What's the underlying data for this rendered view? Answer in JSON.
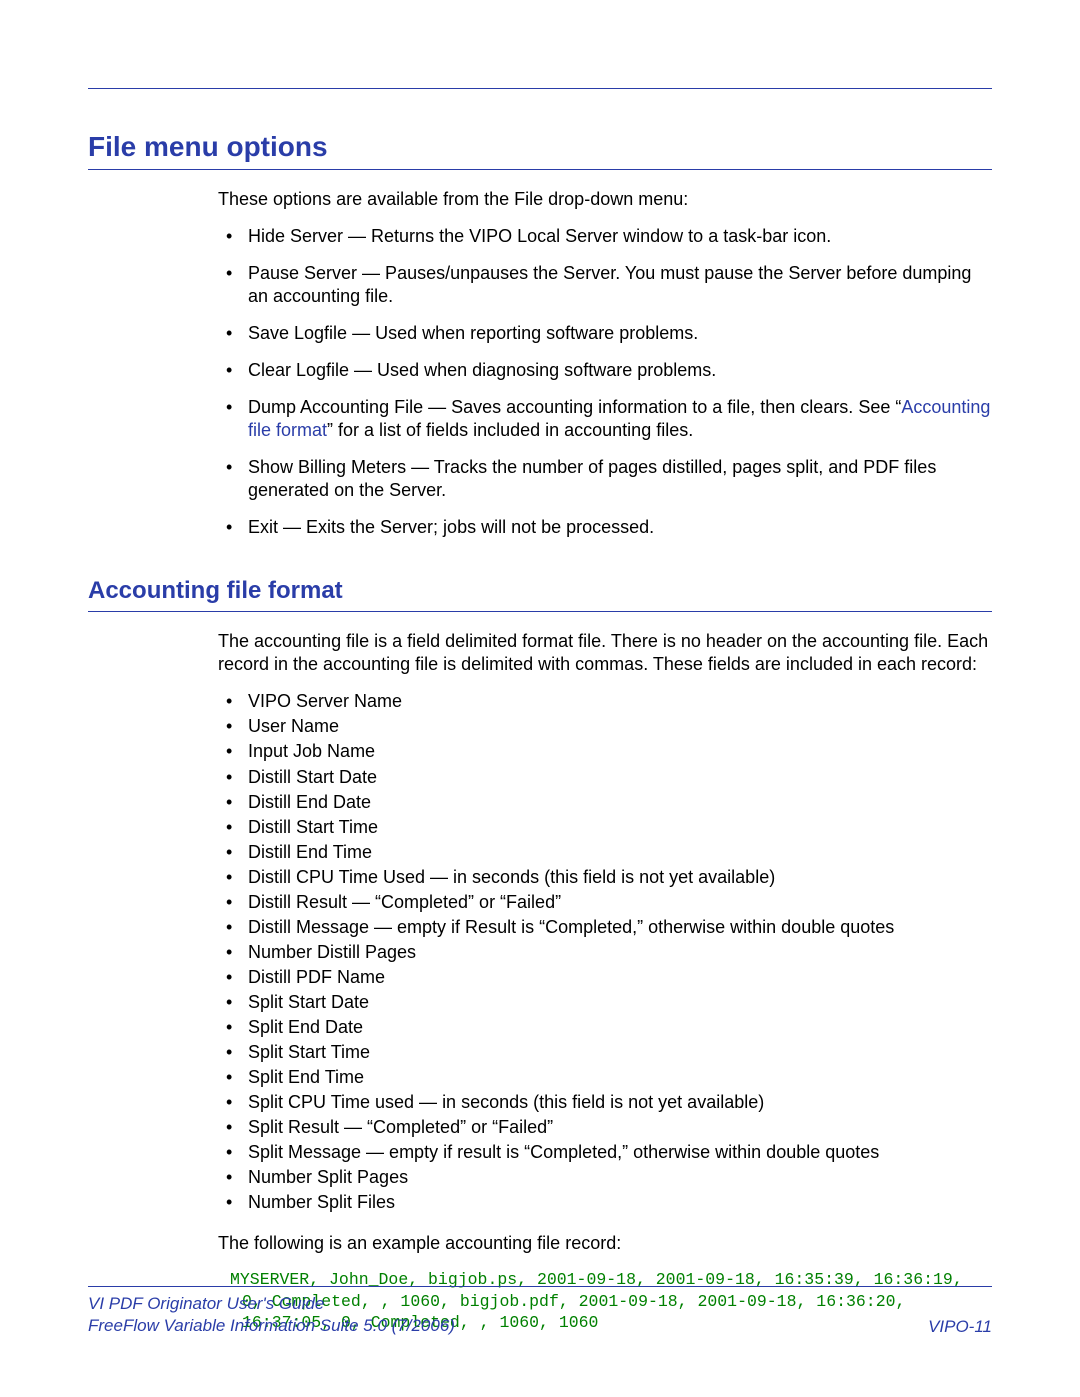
{
  "section1": {
    "title": "File menu options",
    "intro": "These options are available from the File drop-down menu:",
    "items": [
      {
        "text": "Hide Server — Returns the VIPO Local Server window to a task-bar icon."
      },
      {
        "text": "Pause Server — Pauses/unpauses the Server. You must pause the Server before dumping an accounting file."
      },
      {
        "text": "Save Logfile — Used when reporting software problems."
      },
      {
        "text": "Clear Logfile — Used when diagnosing software problems."
      },
      {
        "pre": "Dump Accounting File — Saves accounting information to a file, then clears. See “",
        "link": "Accounting file format",
        "post": "” for a list of fields included in accounting files."
      },
      {
        "text": "Show Billing Meters — Tracks the number of pages distilled, pages split, and PDF files generated on the Server."
      },
      {
        "text": "Exit — Exits the Server; jobs will not be processed."
      }
    ]
  },
  "section2": {
    "title": "Accounting file format",
    "intro": "The accounting file is a field delimited format file. There is no header on the accounting file. Each record in the accounting file is delimited with commas. These fields are included in each record:",
    "fields": [
      "VIPO Server Name",
      "User Name",
      "Input Job Name",
      "Distill Start Date",
      "Distill End Date",
      "Distill Start Time",
      "Distill End Time",
      "Distill CPU Time Used — in seconds (this field is not yet available)",
      "Distill Result — “Completed” or “Failed”",
      "Distill Message — empty if Result is “Completed,” otherwise within double quotes",
      "Number Distill Pages",
      "Distill PDF Name",
      "Split Start Date",
      "Split End Date",
      "Split Start Time",
      "Split End Time",
      "Split CPU Time used — in seconds (this field is not yet available)",
      "Split Result — “Completed” or “Failed”",
      "Split Message — empty if result is “Completed,” otherwise within double quotes",
      "Number Split Pages",
      "Number Split Files"
    ],
    "example_intro": "The following is an example accounting file record:",
    "example_lines": [
      "MYSERVER, John_Doe, bigjob.ps, 2001-09-18, 2001-09-18, 16:35:39, 16:36:19, 0, Completed, , 1060, bigjob.pdf, 2001-09-18, 2001-09-18, 16:36:20, 16:37:05, 0, Completed, , 1060, 1060"
    ]
  },
  "footer": {
    "guide": "VI PDF Originator User's Guide",
    "suite": "FreeFlow Variable Information Suite 5.0 (7/2006)",
    "page": "VIPO-11"
  }
}
